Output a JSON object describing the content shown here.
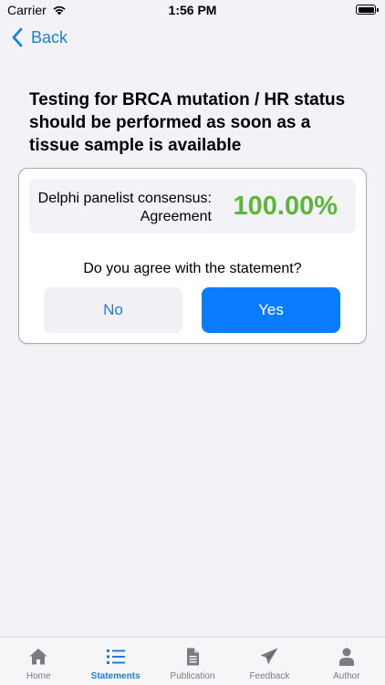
{
  "status_bar": {
    "carrier": "Carrier",
    "time": "1:56 PM"
  },
  "nav": {
    "back_label": "Back"
  },
  "statement": {
    "text": "Testing for BRCA mutation / HR status should be performed as soon as a tissue sample is available"
  },
  "consensus": {
    "label": "Delphi panelist consensus: Agreement",
    "value": "100.00%",
    "value_color": "#5cb63a"
  },
  "question": {
    "text": "Do you agree with the statement?",
    "no_label": "No",
    "yes_label": "Yes"
  },
  "tab_bar": {
    "active_tab": "Statements",
    "accent_color": "#1a7fe0",
    "tabs": [
      {
        "label": "Home",
        "icon": "home-icon"
      },
      {
        "label": "Statements",
        "icon": "list-icon"
      },
      {
        "label": "Publication",
        "icon": "document-icon"
      },
      {
        "label": "Feedback",
        "icon": "paper-plane-icon"
      },
      {
        "label": "Author",
        "icon": "person-icon"
      }
    ]
  }
}
